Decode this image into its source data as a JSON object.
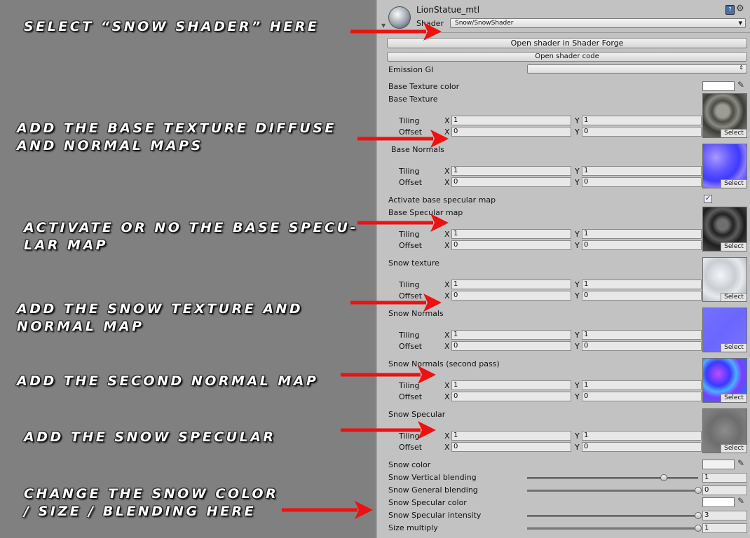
{
  "notes": [
    "Select “Snow Shader” here",
    "Add the base texture diffuse\nand normal maps",
    "Activate or no the base specu-\nlar map",
    "Add the snow texture and\nnormal map",
    "Add the second normal map",
    "Add the snow specular",
    "Change the snow color\n/ size / blending here"
  ],
  "header": {
    "material_name": "LionStatue_mtl",
    "shader_label": "Shader",
    "shader_value": "Snow/SnowShader",
    "help_icon": "book-help-icon",
    "settings_icon": "gear-icon"
  },
  "buttons": {
    "open_shader_forge": "Open shader in Shader Forge",
    "open_shader_code": "Open shader code"
  },
  "emission": {
    "label": "Emission GI",
    "value": ""
  },
  "labels": {
    "base_texture_color": "Base Texture color",
    "activate_specular": "Activate base specular map",
    "snow_color": "Snow color",
    "snow_vertical_blending": "Snow Vertical blending",
    "snow_general_blending": "Snow General blending",
    "snow_specular_color": "Snow Specular color",
    "snow_specular_intensity": "Snow Specular intensity",
    "size_multiply": "Size multiply"
  },
  "common": {
    "tiling": "Tiling",
    "offset": "Offset",
    "x": "X",
    "y": "Y",
    "select": "Select"
  },
  "textures": [
    {
      "label": "Base Texture",
      "tiling_x": "1",
      "tiling_y": "1",
      "offset_x": "0",
      "offset_y": "0"
    },
    {
      "label": "Base Normals",
      "tiling_x": "1",
      "tiling_y": "1",
      "offset_x": "0",
      "offset_y": "0"
    },
    {
      "label": "Base Specular map",
      "tiling_x": "1",
      "tiling_y": "1",
      "offset_x": "0",
      "offset_y": "0"
    },
    {
      "label": "Snow texture",
      "tiling_x": "1",
      "tiling_y": "1",
      "offset_x": "0",
      "offset_y": "0"
    },
    {
      "label": "Snow Normals",
      "tiling_x": "1",
      "tiling_y": "1",
      "offset_x": "0",
      "offset_y": "0"
    },
    {
      "label": "Snow Normals (second pass)",
      "tiling_x": "1",
      "tiling_y": "1",
      "offset_x": "0",
      "offset_y": "0"
    },
    {
      "label": "Snow Specular",
      "tiling_x": "1",
      "tiling_y": "1",
      "offset_x": "0",
      "offset_y": "0"
    }
  ],
  "activate_specular_checked": true,
  "sliders": {
    "snow_vertical_blending": {
      "value": "1",
      "fraction": 0.8
    },
    "snow_general_blending": {
      "value": "0",
      "fraction": 1.0
    },
    "snow_specular_intensity": {
      "value": "3",
      "fraction": 1.0
    },
    "size_multiply": {
      "value": "1",
      "fraction": 1.0
    }
  },
  "colors": {
    "arrow": "#ee1111",
    "snow_color": "#f2f2f2",
    "base_texture_color": "#ffffff",
    "snow_specular_color": "#ffffff"
  }
}
